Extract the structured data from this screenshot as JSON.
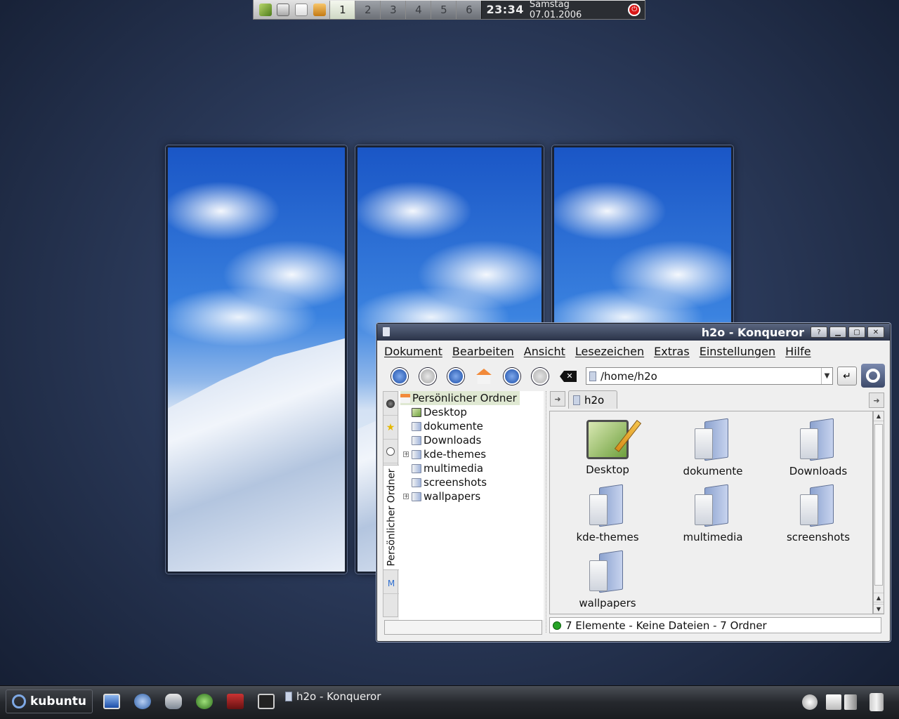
{
  "top_panel": {
    "desktops": [
      "1",
      "2",
      "3",
      "4",
      "5",
      "6"
    ],
    "active_desktop": "1",
    "clock_time": "23:34",
    "clock_date": "Samstag 07.01.2006",
    "quick_launch": [
      "kate-icon",
      "save-icon",
      "notepad-icon",
      "package-icon"
    ]
  },
  "window": {
    "title": "h2o - Konqueror",
    "menu": [
      "Dokument",
      "Bearbeiten",
      "Ansicht",
      "Lesezeichen",
      "Extras",
      "Einstellungen",
      "Hilfe"
    ],
    "address": "/home/h2o",
    "sidebar_tab_label": "Persönlicher Ordner",
    "tree_root": "Persönlicher Ordner",
    "tree_items": [
      "Desktop",
      "dokumente",
      "Downloads",
      "kde-themes",
      "multimedia",
      "screenshots",
      "wallpapers"
    ],
    "tab_label": "h2o",
    "files": [
      "Desktop",
      "dokumente",
      "Downloads",
      "kde-themes",
      "multimedia",
      "screenshots",
      "wallpapers"
    ],
    "status": "7 Elemente - Keine Dateien - 7 Ordner"
  },
  "bottom_panel": {
    "kmenu_label": "kubuntu",
    "task_title": "h2o - Konqueror"
  },
  "colors": {
    "accent": "#2b3348",
    "status_ok": "#26a326",
    "logout": "#d81818"
  }
}
